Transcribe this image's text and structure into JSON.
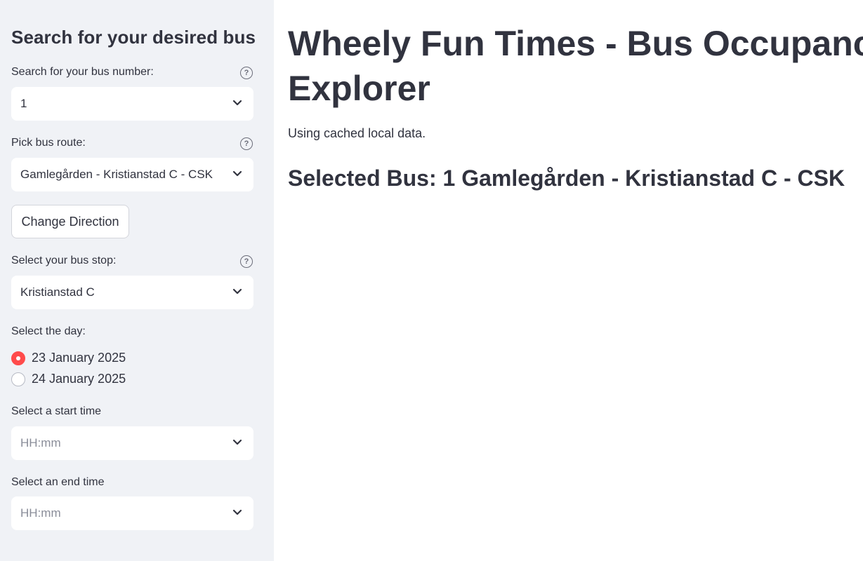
{
  "sidebar": {
    "title": "Search for your desired bus",
    "bus_number": {
      "label": "Search for your bus number:",
      "value": "1"
    },
    "route": {
      "label": "Pick bus route:",
      "value": "Gamlegården - Kristianstad C - CSK"
    },
    "change_direction_label": "Change Direction",
    "stop": {
      "label": "Select your bus stop:",
      "value": "Kristianstad C"
    },
    "day": {
      "label": "Select the day:",
      "options": [
        "23 January 2025",
        "24 January 2025"
      ],
      "selected": "23 January 2025"
    },
    "start_time": {
      "label": "Select a start time",
      "placeholder": "HH:mm"
    },
    "end_time": {
      "label": "Select an end time",
      "placeholder": "HH:mm"
    }
  },
  "main": {
    "title_line1": "Wheely Fun Times - Bus Occupancy",
    "title_line2": "Explorer",
    "info": "Using cached local data.",
    "selected_bus": "Selected Bus: 1 Gamlegården - Kristianstad C - CSK"
  },
  "colors": {
    "accent": "#ff4b4b",
    "sidebar_bg": "#f0f2f6",
    "text": "#31333f"
  },
  "icons": {
    "help": "help-circle-icon",
    "dropdown": "chevron-down-icon"
  }
}
